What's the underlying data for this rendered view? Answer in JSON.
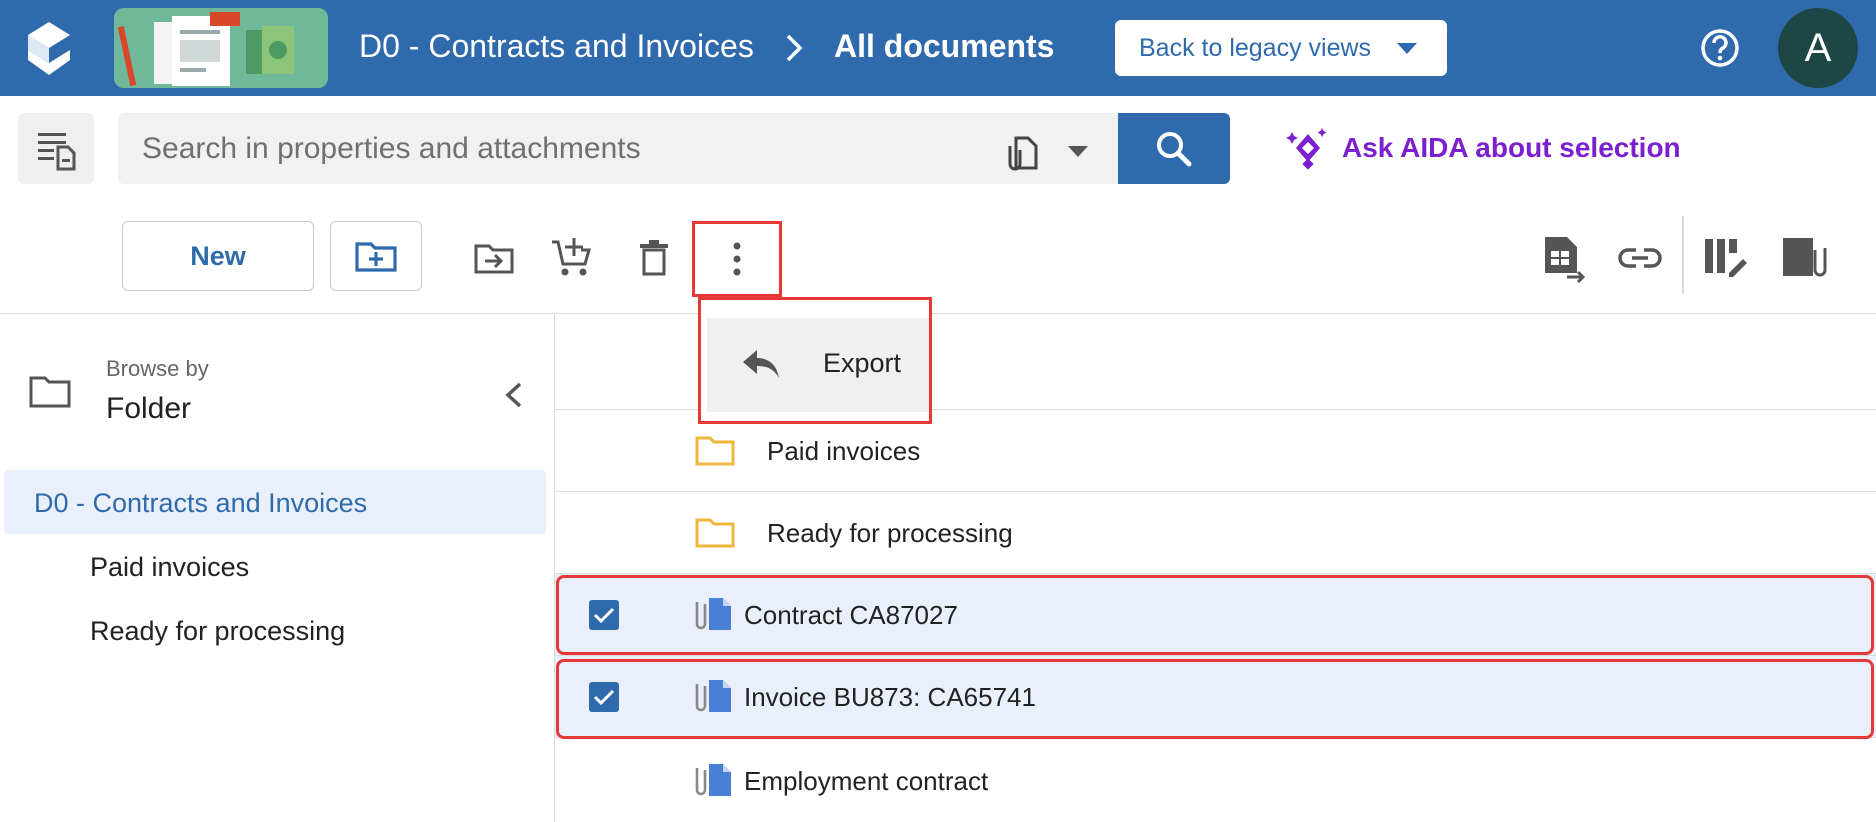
{
  "header": {
    "breadcrumb_root": "D0 - Contracts and Invoices",
    "breadcrumb_current": "All documents",
    "legacy_button": "Back to legacy views",
    "avatar_initial": "A"
  },
  "search": {
    "placeholder": "Search in properties and attachments",
    "aida_label": "Ask AIDA about selection"
  },
  "toolbar": {
    "new_label": "New"
  },
  "more_menu": {
    "items": [
      {
        "label": "Export",
        "icon": "reply-arrow-icon"
      }
    ]
  },
  "browse": {
    "label": "Browse by",
    "value": "Folder"
  },
  "tree": {
    "root": "D0 - Contracts and Invoices",
    "children": [
      "Paid invoices",
      "Ready for processing"
    ]
  },
  "list": {
    "folders": [
      "Paid invoices",
      "Ready for processing"
    ],
    "documents": [
      {
        "name": "Contract CA87027",
        "selected": true
      },
      {
        "name": "Invoice BU873: CA65741",
        "selected": true
      },
      {
        "name": "Employment contract",
        "selected": false
      }
    ]
  },
  "colors": {
    "brand_blue": "#2f6aad",
    "aida_purple": "#7b1fcf",
    "highlight_red": "#e53935",
    "folder_yellow": "#f2b53b",
    "document_blue": "#4a7fd6",
    "selected_row": "#eaf0fb"
  }
}
